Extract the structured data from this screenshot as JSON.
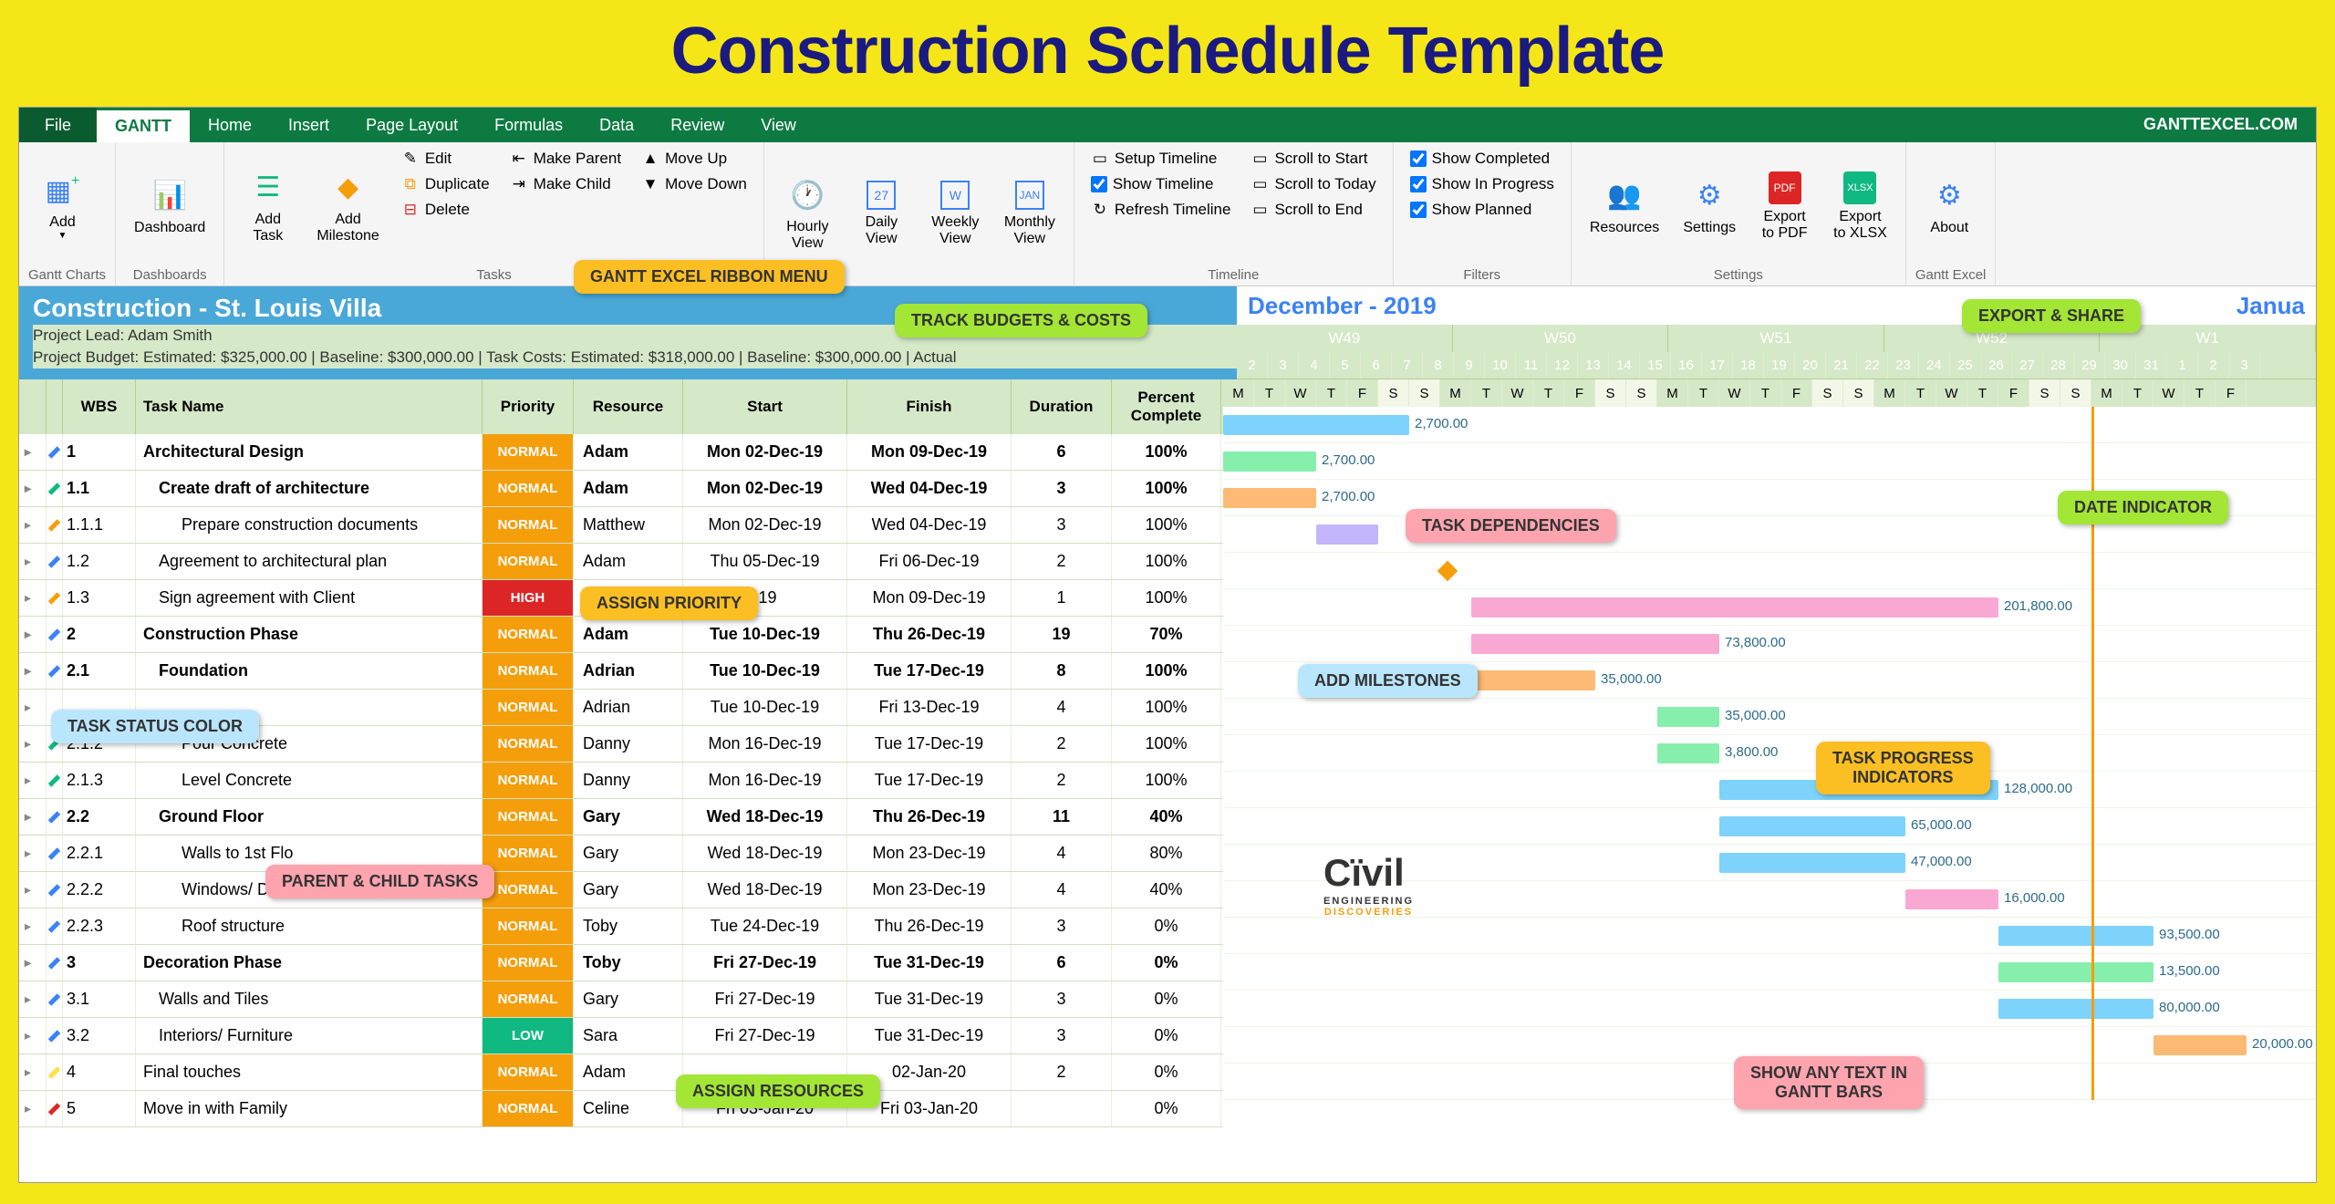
{
  "banner": "Construction Schedule Template",
  "brand": "GANTTEXCEL.COM",
  "tabs": [
    "File",
    "GANTT",
    "Home",
    "Insert",
    "Page Layout",
    "Formulas",
    "Data",
    "Review",
    "View"
  ],
  "ribbon": {
    "groups": {
      "ganttCharts": {
        "label": "Gantt Charts",
        "add": "Add"
      },
      "dashboards": {
        "label": "Dashboards",
        "dashboard": "Dashboard"
      },
      "tasks": {
        "label": "Tasks",
        "addTask": "Add\nTask",
        "addMilestone": "Add\nMilestone",
        "edit": "Edit",
        "duplicate": "Duplicate",
        "delete": "Delete",
        "makeParent": "Make Parent",
        "makeChild": "Make Child",
        "moveUp": "Move Up",
        "moveDown": "Move Down"
      },
      "views": {
        "hourly": "Hourly\nView",
        "daily": "Daily\nView",
        "weekly": "Weekly\nView",
        "monthly": "Monthly\nView"
      },
      "timeline": {
        "label": "Timeline",
        "setup": "Setup Timeline",
        "show": "Show Timeline",
        "refresh": "Refresh Timeline",
        "scrollStart": "Scroll to Start",
        "scrollToday": "Scroll to Today",
        "scrollEnd": "Scroll to End"
      },
      "filters": {
        "label": "Filters",
        "completed": "Show Completed",
        "inProgress": "Show In Progress",
        "planned": "Show Planned"
      },
      "settings": {
        "label": "Settings",
        "resources": "Resources",
        "settings": "Settings",
        "pdf": "Export\nto PDF",
        "xlsx": "Export\nto XLSX"
      },
      "excel": {
        "label": "Gantt Excel",
        "about": "About"
      }
    }
  },
  "project": {
    "title": "Construction - St. Louis Villa",
    "lead": "Project Lead: Adam Smith",
    "budget": "Project Budget: Estimated: $325,000.00 | Baseline: $300,000.00 | Task Costs: Estimated: $318,000.00 | Baseline: $300,000.00 | Actual"
  },
  "columns": {
    "wbs": "WBS",
    "name": "Task Name",
    "priority": "Priority",
    "resource": "Resource",
    "start": "Start",
    "finish": "Finish",
    "duration": "Duration",
    "percent": "Percent\nComplete"
  },
  "month": "December - 2019",
  "month2": "Janua",
  "weeks": [
    "W49",
    "W50",
    "W51",
    "W52",
    "W1"
  ],
  "days": [
    "2",
    "3",
    "4",
    "5",
    "6",
    "7",
    "8",
    "9",
    "10",
    "11",
    "12",
    "13",
    "14",
    "15",
    "16",
    "17",
    "18",
    "19",
    "20",
    "21",
    "22",
    "23",
    "24",
    "25",
    "26",
    "27",
    "28",
    "29",
    "30",
    "31",
    "1",
    "2",
    "3"
  ],
  "dow": [
    "M",
    "T",
    "W",
    "T",
    "F",
    "S",
    "S",
    "M",
    "T",
    "W",
    "T",
    "F",
    "S",
    "S",
    "M",
    "T",
    "W",
    "T",
    "F",
    "S",
    "S",
    "M",
    "T",
    "W",
    "T",
    "F",
    "S",
    "S",
    "M",
    "T",
    "W",
    "T",
    "F"
  ],
  "rows": [
    {
      "status": "#3b82f6",
      "wbs": "1",
      "name": "Architectural Design",
      "indent": 0,
      "bold": true,
      "priority": "NORMAL",
      "resource": "Adam",
      "start": "Mon 02-Dec-19",
      "finish": "Mon 09-Dec-19",
      "duration": "6",
      "percent": "100%",
      "bar": {
        "start": 0,
        "len": 6,
        "color": "blue",
        "label": "2,700.00"
      }
    },
    {
      "status": "#10b981",
      "wbs": "1.1",
      "name": "Create draft of architecture",
      "indent": 1,
      "bold": true,
      "priority": "NORMAL",
      "resource": "Adam",
      "start": "Mon 02-Dec-19",
      "finish": "Wed 04-Dec-19",
      "duration": "3",
      "percent": "100%",
      "bar": {
        "start": 0,
        "len": 3,
        "color": "green",
        "label": "2,700.00"
      }
    },
    {
      "status": "#f59e0b",
      "wbs": "1.1.1",
      "name": "Prepare construction documents",
      "indent": 2,
      "bold": false,
      "priority": "NORMAL",
      "resource": "Matthew",
      "start": "Mon 02-Dec-19",
      "finish": "Wed 04-Dec-19",
      "duration": "3",
      "percent": "100%",
      "bar": {
        "start": 0,
        "len": 3,
        "color": "orange",
        "label": "2,700.00"
      }
    },
    {
      "status": "#3b82f6",
      "wbs": "1.2",
      "name": "Agreement to architectural plan",
      "indent": 1,
      "bold": false,
      "priority": "NORMAL",
      "resource": "Adam",
      "start": "Thu 05-Dec-19",
      "finish": "Fri 06-Dec-19",
      "duration": "2",
      "percent": "100%",
      "bar": {
        "start": 3,
        "len": 2,
        "color": "purple",
        "label": ""
      }
    },
    {
      "status": "#f59e0b",
      "wbs": "1.3",
      "name": "Sign agreement with Client",
      "indent": 1,
      "bold": false,
      "priority": "HIGH",
      "resource": "",
      "start": "-19",
      "finish": "Mon 09-Dec-19",
      "duration": "1",
      "percent": "100%",
      "milestone": {
        "day": 7
      }
    },
    {
      "status": "#3b82f6",
      "wbs": "2",
      "name": "Construction Phase",
      "indent": 0,
      "bold": true,
      "priority": "NORMAL",
      "resource": "Adam",
      "start": "Tue 10-Dec-19",
      "finish": "Thu 26-Dec-19",
      "duration": "19",
      "percent": "70%",
      "bar": {
        "start": 8,
        "len": 17,
        "color": "pink",
        "label": "201,800.00"
      }
    },
    {
      "status": "#3b82f6",
      "wbs": "2.1",
      "name": "Foundation",
      "indent": 1,
      "bold": true,
      "priority": "NORMAL",
      "resource": "Adrian",
      "start": "Tue 10-Dec-19",
      "finish": "Tue 17-Dec-19",
      "duration": "8",
      "percent": "100%",
      "bar": {
        "start": 8,
        "len": 8,
        "color": "pink",
        "label": "73,800.00"
      }
    },
    {
      "status": "",
      "wbs": "",
      "name": "",
      "indent": 2,
      "bold": false,
      "priority": "NORMAL",
      "resource": "Adrian",
      "start": "Tue 10-Dec-19",
      "finish": "Fri 13-Dec-19",
      "duration": "4",
      "percent": "100%",
      "bar": {
        "start": 8,
        "len": 4,
        "color": "orange",
        "label": "35,000.00"
      }
    },
    {
      "status": "#10b981",
      "wbs": "2.1.2",
      "name": "Pour Concrete",
      "indent": 2,
      "bold": false,
      "priority": "NORMAL",
      "resource": "Danny",
      "start": "Mon 16-Dec-19",
      "finish": "Tue 17-Dec-19",
      "duration": "2",
      "percent": "100%",
      "bar": {
        "start": 14,
        "len": 2,
        "color": "green",
        "label": "35,000.00"
      }
    },
    {
      "status": "#10b981",
      "wbs": "2.1.3",
      "name": "Level Concrete",
      "indent": 2,
      "bold": false,
      "priority": "NORMAL",
      "resource": "Danny",
      "start": "Mon 16-Dec-19",
      "finish": "Tue 17-Dec-19",
      "duration": "2",
      "percent": "100%",
      "bar": {
        "start": 14,
        "len": 2,
        "color": "green",
        "label": "3,800.00"
      }
    },
    {
      "status": "#3b82f6",
      "wbs": "2.2",
      "name": "Ground Floor",
      "indent": 1,
      "bold": true,
      "priority": "NORMAL",
      "resource": "Gary",
      "start": "Wed 18-Dec-19",
      "finish": "Thu 26-Dec-19",
      "duration": "11",
      "percent": "40%",
      "bar": {
        "start": 16,
        "len": 9,
        "color": "blue",
        "label": "128,000.00"
      }
    },
    {
      "status": "#3b82f6",
      "wbs": "2.2.1",
      "name": "Walls to 1st Flo",
      "indent": 2,
      "bold": false,
      "priority": "NORMAL",
      "resource": "Gary",
      "start": "Wed 18-Dec-19",
      "finish": "Mon 23-Dec-19",
      "duration": "4",
      "percent": "80%",
      "bar": {
        "start": 16,
        "len": 6,
        "color": "blue",
        "label": "65,000.00"
      }
    },
    {
      "status": "#3b82f6",
      "wbs": "2.2.2",
      "name": "Windows/ Door",
      "indent": 2,
      "bold": false,
      "priority": "NORMAL",
      "resource": "Gary",
      "start": "Wed 18-Dec-19",
      "finish": "Mon 23-Dec-19",
      "duration": "4",
      "percent": "40%",
      "bar": {
        "start": 16,
        "len": 6,
        "color": "blue",
        "label": "47,000.00"
      }
    },
    {
      "status": "#3b82f6",
      "wbs": "2.2.3",
      "name": "Roof structure",
      "indent": 2,
      "bold": false,
      "priority": "NORMAL",
      "resource": "Toby",
      "start": "Tue 24-Dec-19",
      "finish": "Thu 26-Dec-19",
      "duration": "3",
      "percent": "0%",
      "bar": {
        "start": 22,
        "len": 3,
        "color": "pink",
        "label": "16,000.00"
      }
    },
    {
      "status": "#3b82f6",
      "wbs": "3",
      "name": "Decoration Phase",
      "indent": 0,
      "bold": true,
      "priority": "NORMAL",
      "resource": "Toby",
      "start": "Fri 27-Dec-19",
      "finish": "Tue 31-Dec-19",
      "duration": "6",
      "percent": "0%",
      "bar": {
        "start": 25,
        "len": 5,
        "color": "blue",
        "label": "93,500.00"
      }
    },
    {
      "status": "#3b82f6",
      "wbs": "3.1",
      "name": "Walls and Tiles",
      "indent": 1,
      "bold": false,
      "priority": "NORMAL",
      "resource": "Gary",
      "start": "Fri 27-Dec-19",
      "finish": "Tue 31-Dec-19",
      "duration": "3",
      "percent": "0%",
      "bar": {
        "start": 25,
        "len": 5,
        "color": "green",
        "label": "13,500.00"
      }
    },
    {
      "status": "#3b82f6",
      "wbs": "3.2",
      "name": "Interiors/ Furniture",
      "indent": 1,
      "bold": false,
      "priority": "LOW",
      "resource": "Sara",
      "start": "Fri 27-Dec-19",
      "finish": "Tue 31-Dec-19",
      "duration": "3",
      "percent": "0%",
      "bar": {
        "start": 25,
        "len": 5,
        "color": "blue",
        "label": "80,000.00"
      }
    },
    {
      "status": "#fde047",
      "wbs": "4",
      "name": "Final touches",
      "indent": 0,
      "bold": false,
      "priority": "NORMAL",
      "resource": "Adam",
      "start": "",
      "finish": "02-Jan-20",
      "duration": "2",
      "percent": "0%",
      "bar": {
        "start": 30,
        "len": 3,
        "color": "orange",
        "label": "20,000.00"
      }
    },
    {
      "status": "#dc2626",
      "wbs": "5",
      "name": "Move in with Family",
      "indent": 0,
      "bold": false,
      "priority": "NORMAL",
      "resource": "Celine",
      "start": "Fri 03-Jan-20",
      "finish": "Fri 03-Jan-20",
      "duration": "",
      "percent": "0%"
    }
  ],
  "callouts": {
    "ribbonMenu": "GANTT EXCEL RIBBON MENU",
    "trackBudgets": "TRACK BUDGETS & COSTS",
    "exportShare": "EXPORT & SHARE",
    "taskDeps": "TASK DEPENDENCIES",
    "dateIndicator": "DATE INDICATOR",
    "assignPriority": "ASSIGN PRIORITY",
    "addMilestones": "ADD MILESTONES",
    "taskStatus": "TASK STATUS COLOR",
    "progressInd": "TASK PROGRESS\nINDICATORS",
    "parentChild": "PARENT & CHILD TASKS",
    "assignResources": "ASSIGN RESOURCES",
    "showText": "SHOW ANY TEXT IN\nGANTT BARS"
  },
  "watermark": {
    "main": "Cïvil",
    "sub": "ENGINEERING",
    "sub2": "DISCOVERIES"
  }
}
